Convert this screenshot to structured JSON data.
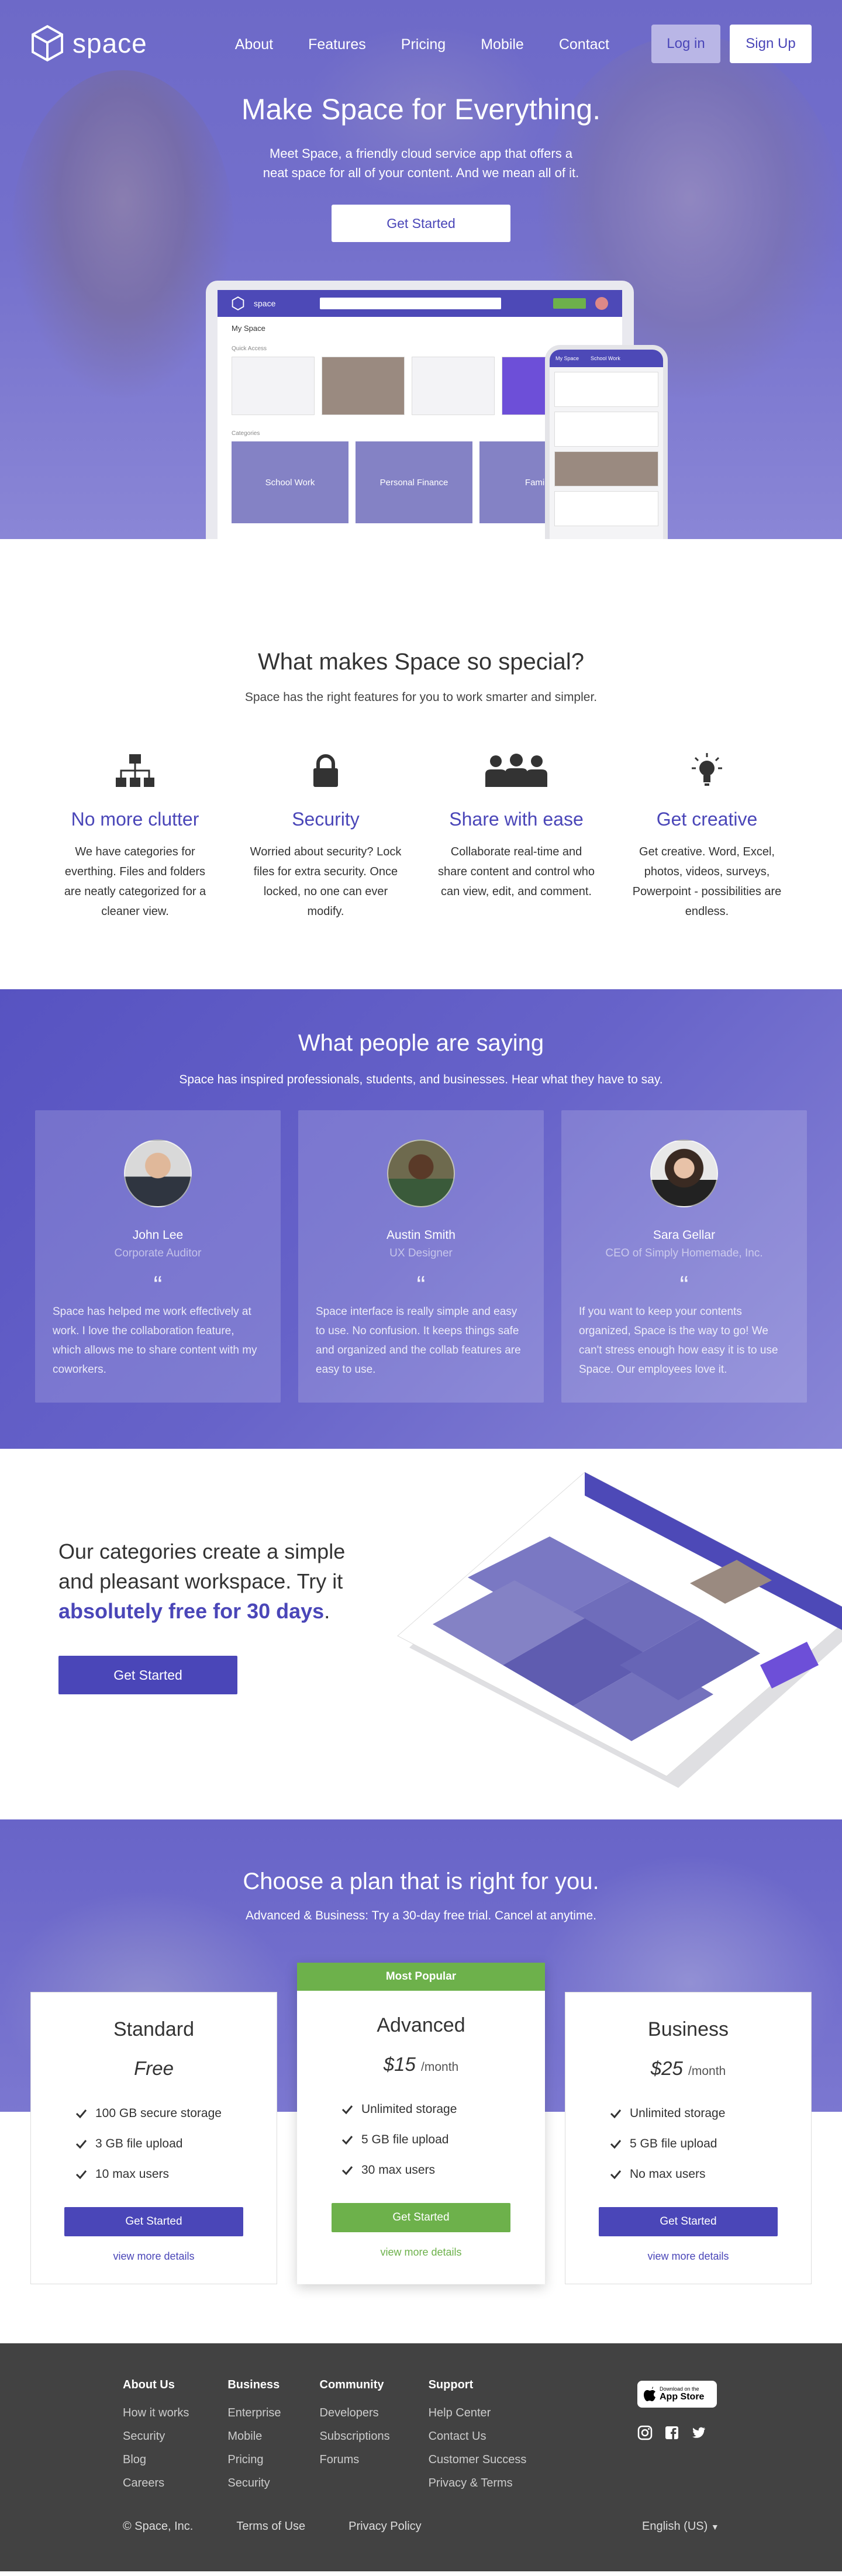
{
  "nav": {
    "logo_text": "space",
    "links": [
      "About",
      "Features",
      "Pricing",
      "Mobile",
      "Contact"
    ],
    "login_label": "Log in",
    "signup_label": "Sign Up"
  },
  "hero": {
    "title": "Make Space for Everything.",
    "description": "Meet Space, a friendly cloud service app that offers a neat space for all of your content. And we mean all of it.",
    "cta_label": "Get Started",
    "mockup": {
      "app_name": "space",
      "page_title": "My Space",
      "quick_access_label": "Quick Access",
      "categories_label": "Categories",
      "categories": [
        "School Work",
        "Personal Finance",
        "Family"
      ],
      "phone_title": "My Space",
      "phone_subtitle": "School Work"
    }
  },
  "special": {
    "title": "What makes Space so special?",
    "subtitle": "Space has the right features for you to work smarter and simpler.",
    "features": [
      {
        "icon": "hierarchy-icon",
        "title": "No more clutter",
        "desc": "We have categories for everthing. Files and folders are neatly categorized for a cleaner view."
      },
      {
        "icon": "lock-icon",
        "title": "Security",
        "desc": "Worried about security? Lock files for extra security. Once locked, no one can ever modify."
      },
      {
        "icon": "people-icon",
        "title": "Share with ease",
        "desc": "Collaborate real-time and share content and control who can view, edit, and comment."
      },
      {
        "icon": "lightbulb-icon",
        "title": "Get creative",
        "desc": "Get creative. Word, Excel, photos, videos, surveys, Powerpoint - possibilities are endless."
      }
    ]
  },
  "testimonials": {
    "title": "What people are saying",
    "subtitle": "Space has inspired professionals, students, and businesses. Hear what they have to say.",
    "items": [
      {
        "name": "John Lee",
        "role": "Corporate Auditor",
        "quote": "Space has helped me work effectively at work. I love the collaboration feature, which allows me to share content with my coworkers."
      },
      {
        "name": "Austin Smith",
        "role": "UX Designer",
        "quote": "Space interface is really simple and easy to use. No confusion. It keeps things safe and organized and the collab features are easy to use."
      },
      {
        "name": "Sara Gellar",
        "role": "CEO of Simply Homemade, Inc.",
        "quote": "If you want to keep your contents organized, Space is the way to go! We can't stress enough how easy it is to use Space. Our employees love it."
      }
    ]
  },
  "categories": {
    "text_before": "Our categories create a simple and pleasant workspace. Try it ",
    "text_highlight": "absolutely free for 30 days",
    "text_after": ".",
    "cta_label": "Get Started"
  },
  "pricing": {
    "title": "Choose a plan that is right for you.",
    "subtitle": "Advanced & Business: Try a 30-day free trial. Cancel at anytime.",
    "plans": [
      {
        "name": "Standard",
        "price": "Free",
        "period": "",
        "features": [
          "100 GB secure storage",
          "3 GB file upload",
          "10 max users"
        ],
        "cta": "Get Started",
        "more": "view more details"
      },
      {
        "name": "Advanced",
        "badge": "Most Popular",
        "price": "$15",
        "period": "/month",
        "features": [
          "Unlimited storage",
          "5 GB file upload",
          "30 max users"
        ],
        "cta": "Get Started",
        "more": "view more details"
      },
      {
        "name": "Business",
        "price": "$25",
        "period": "/month",
        "features": [
          "Unlimited storage",
          "5 GB file upload",
          "No max users"
        ],
        "cta": "Get Started",
        "more": "view more details"
      }
    ]
  },
  "footer": {
    "columns": [
      {
        "title": "About Us",
        "links": [
          "How it works",
          "Security",
          "Blog",
          "Careers"
        ]
      },
      {
        "title": "Business",
        "links": [
          "Enterprise",
          "Mobile",
          "Pricing",
          "Security"
        ]
      },
      {
        "title": "Community",
        "links": [
          "Developers",
          "Subscriptions",
          "Forums"
        ]
      },
      {
        "title": "Support",
        "links": [
          "Help Center",
          "Contact Us",
          "Customer Success",
          "Privacy & Terms"
        ]
      }
    ],
    "appstore_small": "Download on the",
    "appstore_big": "App Store",
    "copyright": "© Space, Inc.",
    "terms": "Terms of Use",
    "privacy": "Privacy Policy",
    "language": "English (US)"
  },
  "colors": {
    "brand": "#4a46b8",
    "accent_green": "#6db14b",
    "footer_bg": "#424242"
  }
}
